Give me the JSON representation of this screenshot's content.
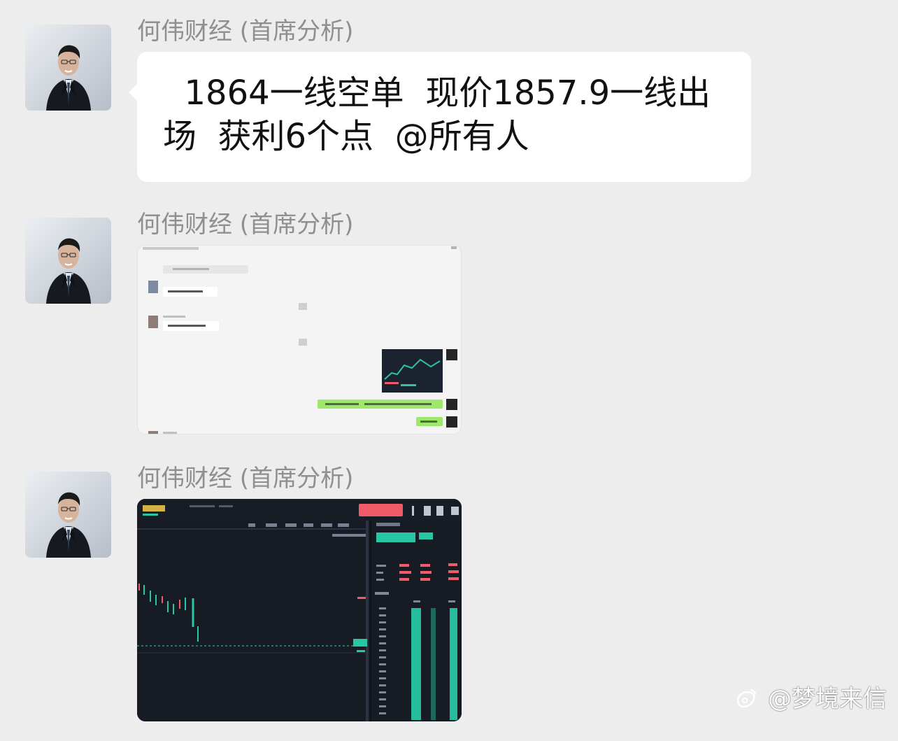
{
  "messages": [
    {
      "sender": "何伟财经 (首席分析)",
      "type": "text",
      "text": "  1864一线空单  现价1857.9一线出场  获利6个点  @所有人"
    },
    {
      "sender": "何伟财经 (首席分析)",
      "type": "image",
      "image_kind": "chat-screenshot"
    },
    {
      "sender": "何伟财经 (首席分析)",
      "type": "image",
      "image_kind": "trading-chart-screenshot"
    }
  ],
  "watermark": {
    "text": "@梦境来信",
    "icon": "weibo-logo-icon"
  },
  "colors": {
    "background": "#ededed",
    "bubble": "#ffffff",
    "sender_text": "#8f8f8f",
    "message_text": "#111111",
    "chart_bg": "#161b24",
    "chart_up": "#27c6a4",
    "chart_down": "#f05a69",
    "chat_green": "#9de86a"
  }
}
